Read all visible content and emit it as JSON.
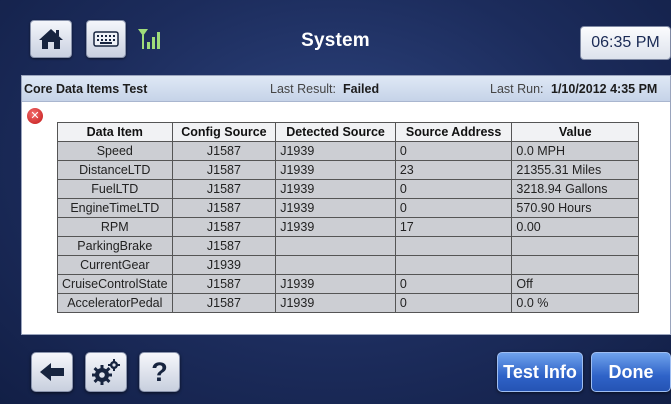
{
  "header": {
    "title": "System",
    "time": "06:35 PM",
    "icons": [
      "home-icon",
      "keyboard-icon",
      "signal-strength-icon"
    ]
  },
  "panel": {
    "test_name": "Core Data Items Test",
    "last_result_label": "Last Result:",
    "last_result": "Failed",
    "last_run_label": "Last Run:",
    "last_run": "1/10/2012 4:35 PM",
    "status_icon": "error-x-icon"
  },
  "table": {
    "columns": [
      "Data Item",
      "Config Source",
      "Detected Source",
      "Source Address",
      "Value"
    ],
    "rows": [
      [
        "Speed",
        "J1587",
        "J1939",
        "0",
        "0.0 MPH"
      ],
      [
        "DistanceLTD",
        "J1587",
        "J1939",
        "23",
        "21355.31 Miles"
      ],
      [
        "FuelLTD",
        "J1587",
        "J1939",
        "0",
        "3218.94 Gallons"
      ],
      [
        "EngineTimeLTD",
        "J1587",
        "J1939",
        "0",
        "570.90 Hours"
      ],
      [
        "RPM",
        "J1587",
        "J1939",
        "17",
        "0.00"
      ],
      [
        "ParkingBrake",
        "J1587",
        "",
        "",
        ""
      ],
      [
        "CurrentGear",
        "J1939",
        "",
        "",
        ""
      ],
      [
        "CruiseControlState",
        "J1587",
        "J1939",
        "0",
        "Off"
      ],
      [
        "AcceleratorPedal",
        "J1587",
        "J1939",
        "0",
        "0.0 %"
      ]
    ]
  },
  "footer": {
    "help_label": "?",
    "test_info_label": "Test Info",
    "done_label": "Done",
    "icons": [
      "back-arrow-icon",
      "settings-gears-icon"
    ]
  },
  "colors": {
    "background": "#1c2c5c",
    "accent_button": "#2f63c8",
    "table_cell": "#ccced3",
    "error": "#c21717"
  }
}
